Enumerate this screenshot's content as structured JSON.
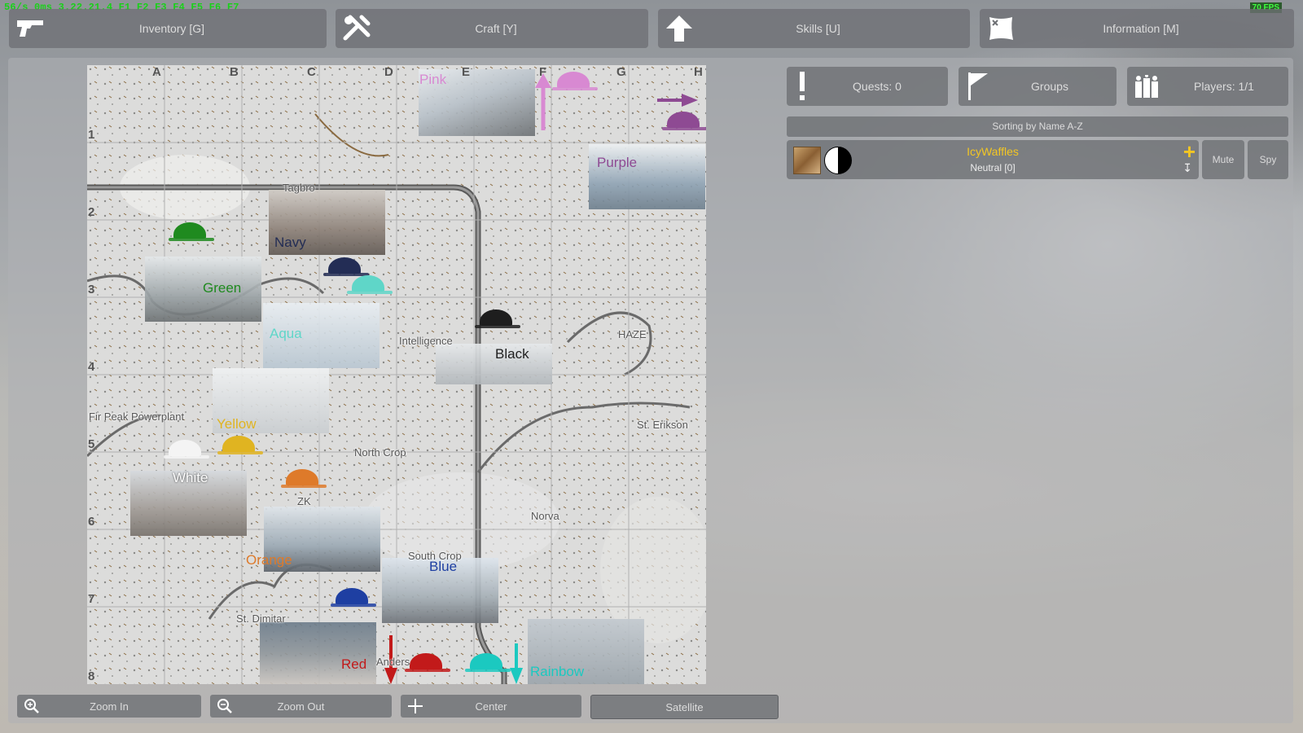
{
  "hud": {
    "debug": "56/s 0ms 3.22.21.4 F1 F2 F3 F4 F5 F6 F7",
    "fps": "70 FPS"
  },
  "topbar": {
    "inventory": "Inventory [G]",
    "craft": "Craft [Y]",
    "skills": "Skills [U]",
    "information": "Information [M]"
  },
  "map": {
    "columns": [
      "A",
      "B",
      "C",
      "D",
      "E",
      "F",
      "G",
      "H"
    ],
    "rows": [
      "1",
      "2",
      "3",
      "4",
      "5",
      "6",
      "7",
      "8"
    ],
    "places": {
      "tagbro": "Tagbro",
      "intelligence": "Intelligence",
      "haze": "HAZE",
      "fir_peak": "Fir Peak Powerplant",
      "north_crop": "North Crop",
      "st_erikson": "St. Erikson",
      "norva": "Norva",
      "zk": "ZK",
      "st_dimitar": "St. Dimitar",
      "south_crop": "South Crop",
      "anders": "Anders"
    },
    "teams": {
      "pink": "Pink",
      "purple": "Purple",
      "navy": "Navy",
      "green": "Green",
      "aqua": "Aqua",
      "black": "Black",
      "yellow": "Yellow",
      "white": "White",
      "orange": "Orange",
      "blue": "Blue",
      "red": "Red",
      "rainbow": "Rainbow"
    },
    "colors": {
      "pink": "#d889d2",
      "purple": "#8e4a93",
      "navy": "#232d55",
      "green": "#1f8a1f",
      "aqua": "#5fd6c8",
      "black": "#1e1e1e",
      "yellow": "#e0b421",
      "white": "#f4f4f4",
      "orange": "#de7a2a",
      "blue": "#1e3fa2",
      "red": "#c21a1a",
      "rainbow": "#1bc9c0"
    }
  },
  "panel": {
    "quests": "Quests: 0",
    "groups": "Groups",
    "players": "Players: 1/1",
    "sorting": "Sorting by Name A-Z",
    "player": {
      "name": "IcyWaffles",
      "faction": "Neutral [0]"
    },
    "mute": "Mute",
    "spy": "Spy"
  },
  "bottombar": {
    "zoom_in": "Zoom In",
    "zoom_out": "Zoom Out",
    "center": "Center",
    "satellite": "Satellite"
  }
}
